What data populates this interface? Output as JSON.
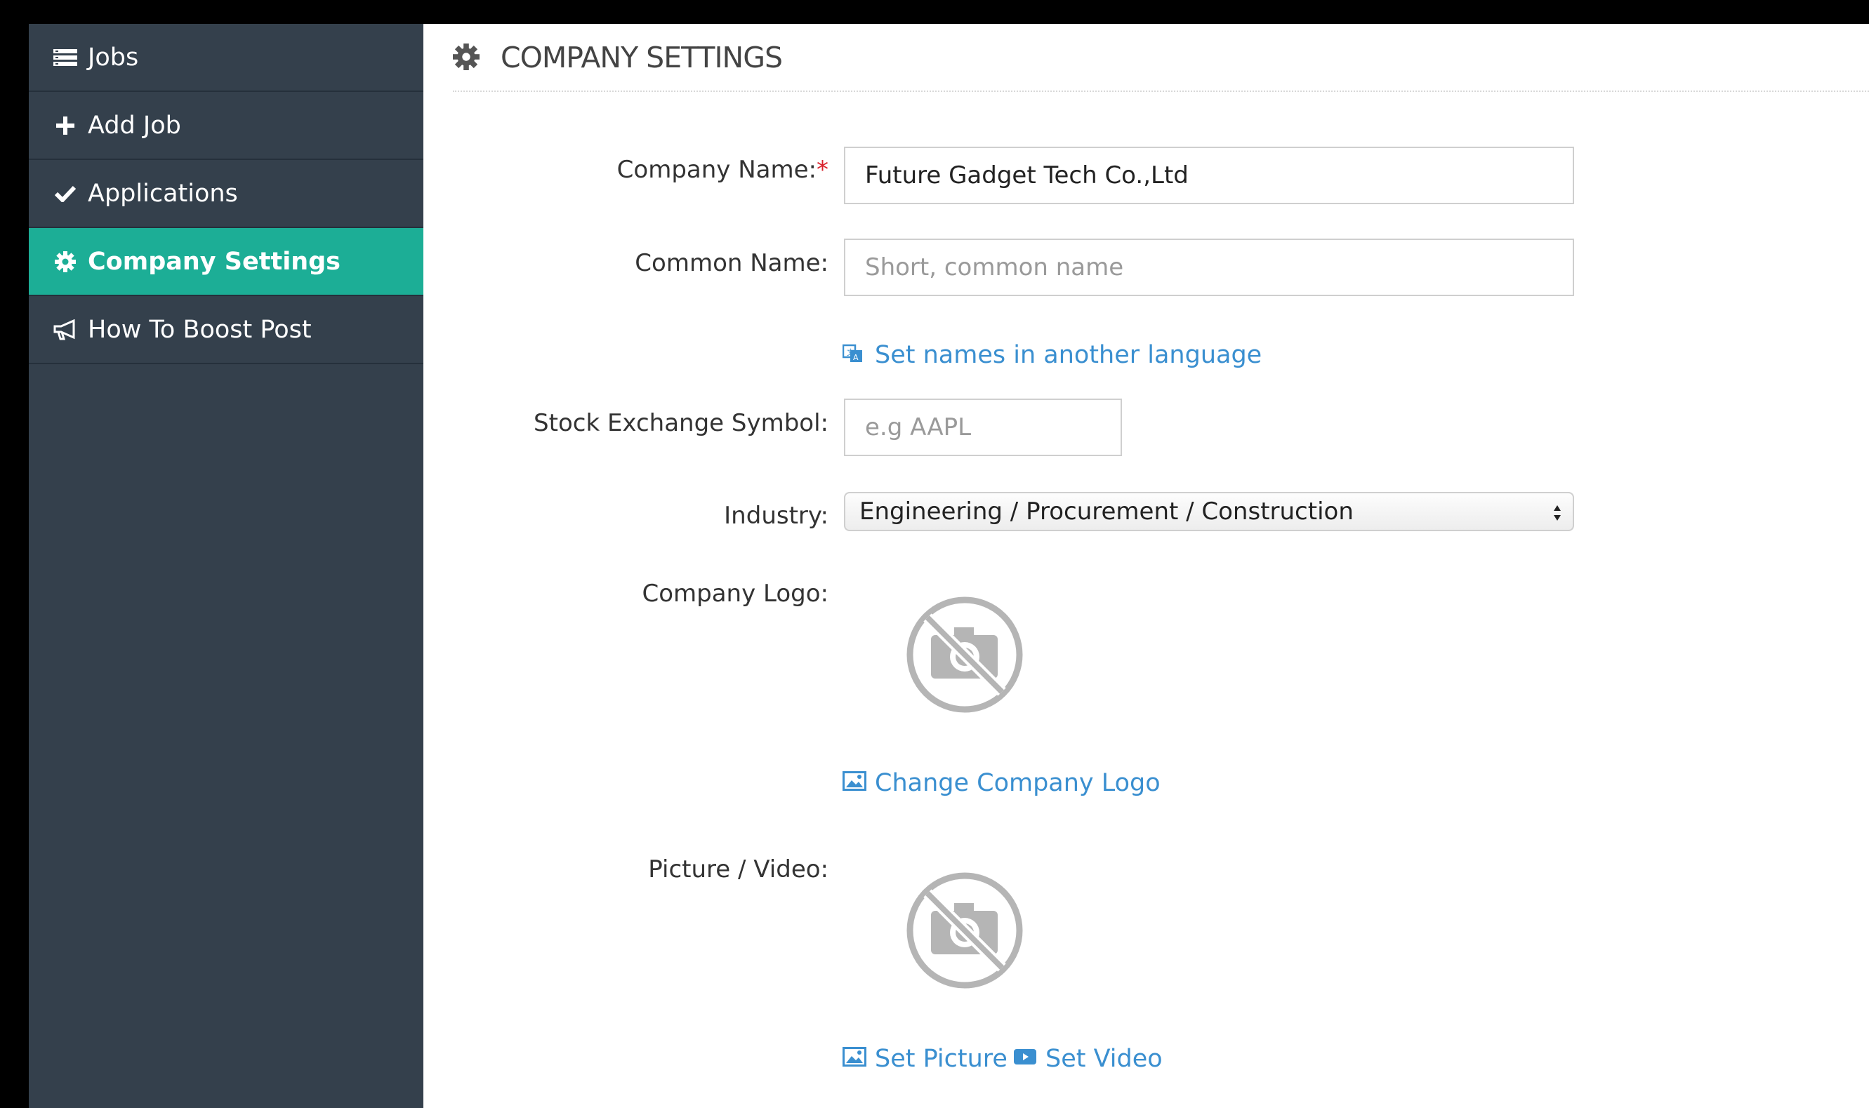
{
  "sidebar": {
    "items": [
      {
        "label": "Jobs",
        "icon": "list-icon"
      },
      {
        "label": "Add Job",
        "icon": "plus-icon"
      },
      {
        "label": "Applications",
        "icon": "checkmark-icon"
      },
      {
        "label": "Company Settings",
        "icon": "gear-icon",
        "active": true
      },
      {
        "label": "How To Boost Post",
        "icon": "megaphone-icon"
      }
    ]
  },
  "header": {
    "title": "COMPANY SETTINGS",
    "icon": "gear-icon"
  },
  "form": {
    "company_name": {
      "label": "Company Name:",
      "required_mark": "*",
      "value": "Future Gadget Tech Co.,Ltd"
    },
    "common_name": {
      "label": "Common Name:",
      "placeholder": "Short, common name"
    },
    "language_link": "Set names in another language",
    "stock_symbol": {
      "label": "Stock Exchange Symbol:",
      "placeholder": "e.g AAPL"
    },
    "industry": {
      "label": "Industry:",
      "selected": "Engineering / Procurement / Construction"
    },
    "logo": {
      "label": "Company Logo:",
      "change_link": "Change Company Logo"
    },
    "media": {
      "label": "Picture / Video:",
      "set_picture": "Set Picture",
      "set_video": "Set Video"
    }
  },
  "colors": {
    "sidebar_bg": "#34404c",
    "active_bg": "#1cae96",
    "link": "#3a8fd0",
    "required": "#d9232d"
  }
}
